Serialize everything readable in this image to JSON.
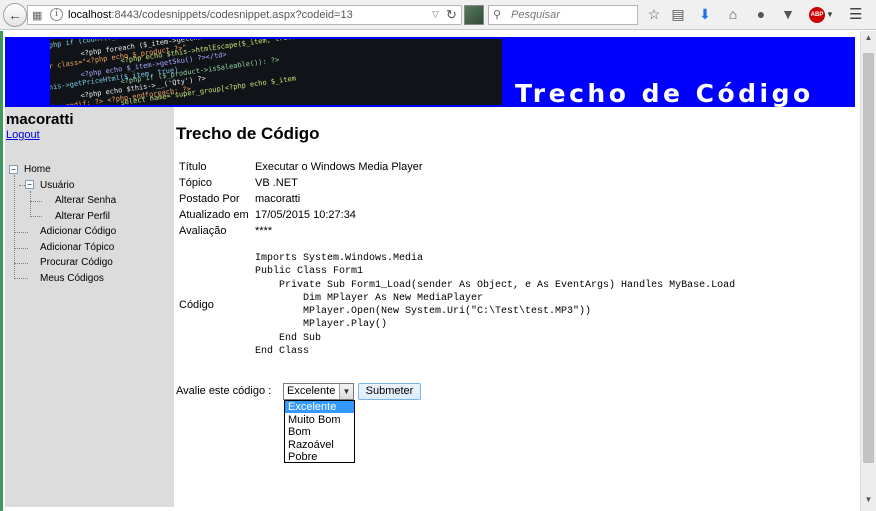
{
  "browser": {
    "url_host": "localhost",
    "url_rest": ":8443/codesnippets/codesnippet.aspx?codeid=13",
    "search_placeholder": "Pesquisar",
    "abp_label": "ABP"
  },
  "banner": {
    "title": "Trecho de Código",
    "code_lines": [
      "<?php if (count($_associatedProducts)): ?>",
      "<?php foreach ($_item->getChildren() as $_child):",
      "<?php echo $this->htmlEscape($_item, true) ?>",
      "<tr class=\"<?php echo $_product ?>\"",
      "<?php echo $_item->getSku() ?></td>",
      "<?php if ($_product->isSaleable()): ?>",
      "$this->getPriceHtml($_item, true)",
      "<?php echo $this->__('Qty') ?>",
      "select name=\"super_group[<?php echo $_item",
      "<?php endif; ?> <?php endforeach; ?>"
    ]
  },
  "sidebar": {
    "username": "macoratti",
    "logout_label": "Logout",
    "tree": {
      "home": "Home",
      "usuario": "Usuário",
      "alterar_senha": "Alterar Senha",
      "alterar_perfil": "Alterar Perfil",
      "adicionar_codigo": "Adicionar Código",
      "adicionar_topico": "Adicionar Tópico",
      "procurar_codigo": "Procurar Código",
      "meus_codigos": "Meus Códigos"
    }
  },
  "main": {
    "title": "Trecho de Código",
    "fields": {
      "titulo_label": "Título",
      "titulo_value": "Executar o Windows Media Player",
      "topico_label": "Tópico",
      "topico_value": "VB .NET",
      "postado_label": "Postado Por",
      "postado_value": "macoratti",
      "atualizado_label": "Atualizado em",
      "atualizado_value": "17/05/2015 10:27:34",
      "avaliacao_label": "Avaliação",
      "avaliacao_value": "****",
      "codigo_label": "Código"
    },
    "code": "Imports System.Windows.Media\nPublic Class Form1\n    Private Sub Form1_Load(sender As Object, e As EventArgs) Handles MyBase.Load\n        Dim MPlayer As New MediaPlayer\n        MPlayer.Open(New System.Uri(\"C:\\Test\\test.MP3\"))\n        MPlayer.Play()\n    End Sub\nEnd Class",
    "rating": {
      "label": "Avalie este código :",
      "selected": "Excelente",
      "options": [
        "Excelente",
        "Muito Bom",
        "Bom",
        "Razoável",
        "Pobre"
      ],
      "submit_label": "Submeter"
    }
  }
}
